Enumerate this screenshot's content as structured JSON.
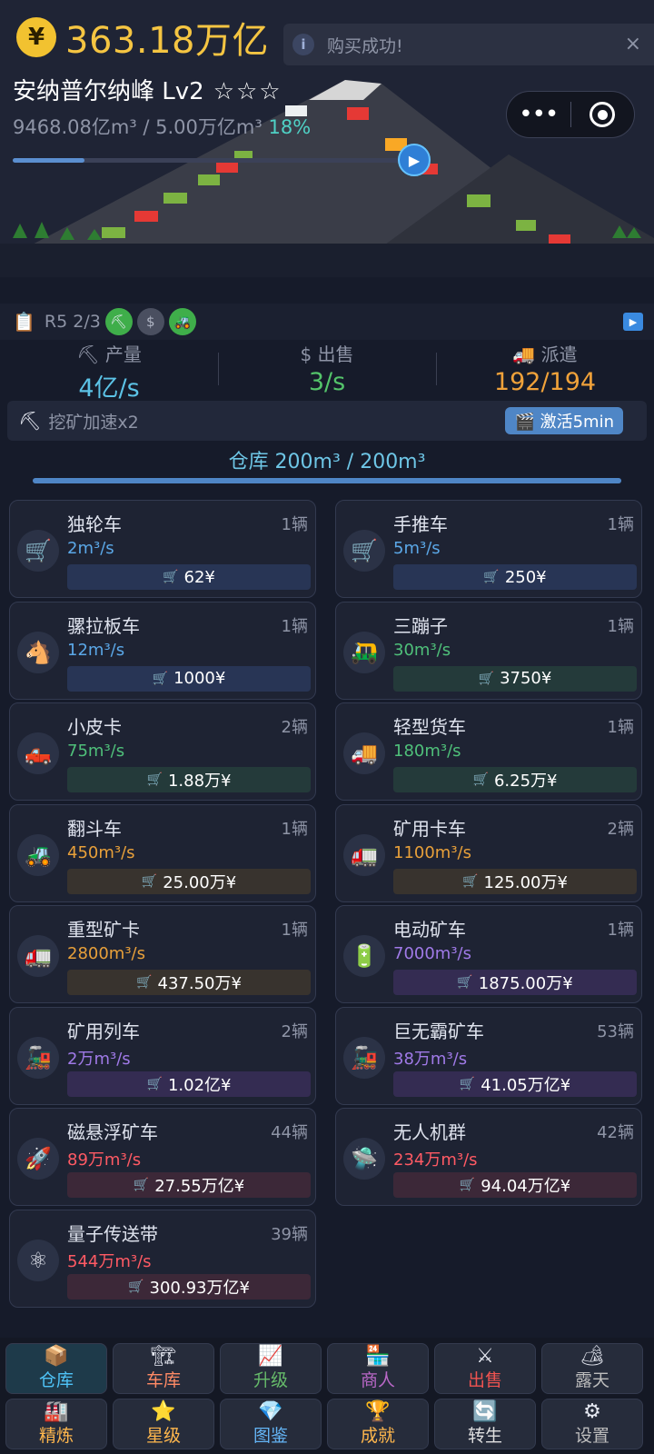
{
  "header": {
    "coin_symbol": "¥",
    "money": "363.18万亿",
    "mine_name": "安纳普尔纳峰 Lv2",
    "stars": "☆☆☆",
    "volume": "9468.08亿m³ / 5.00万亿m³",
    "volume_pct": "18%",
    "progress_fraction": 0.18
  },
  "toast": {
    "info": "i",
    "text": "购买成功!",
    "close": "×"
  },
  "strip": {
    "label": "R5 2/3",
    "badge_pick": "⛏",
    "badge_dollar": "$",
    "badge_tractor": "🚜"
  },
  "stats": [
    {
      "icon": "⛏",
      "label": "产量",
      "value": "4亿/s"
    },
    {
      "icon": "$",
      "label": "出售",
      "value": "3/s"
    },
    {
      "icon": "🚚",
      "label": "派遣",
      "value": "192/194"
    }
  ],
  "boost": {
    "text": "挖矿加速x2",
    "button": "🎬 激活5min"
  },
  "warehouse": {
    "text": "仓库 200m³ / 200m³",
    "fill_fraction": 1.0
  },
  "vehicles": [
    {
      "name": "独轮车",
      "count": "1辆",
      "rate": "2m³/s",
      "price": "62¥",
      "icon": "🛒",
      "tier": "blue"
    },
    {
      "name": "手推车",
      "count": "1辆",
      "rate": "5m³/s",
      "price": "250¥",
      "icon": "🛒",
      "tier": "blue"
    },
    {
      "name": "骡拉板车",
      "count": "1辆",
      "rate": "12m³/s",
      "price": "1000¥",
      "icon": "🐴",
      "tier": "blue"
    },
    {
      "name": "三蹦子",
      "count": "1辆",
      "rate": "30m³/s",
      "price": "3750¥",
      "icon": "🛺",
      "tier": "green"
    },
    {
      "name": "小皮卡",
      "count": "2辆",
      "rate": "75m³/s",
      "price": "1.88万¥",
      "icon": "🛻",
      "tier": "green"
    },
    {
      "name": "轻型货车",
      "count": "1辆",
      "rate": "180m³/s",
      "price": "6.25万¥",
      "icon": "🚚",
      "tier": "green"
    },
    {
      "name": "翻斗车",
      "count": "1辆",
      "rate": "450m³/s",
      "price": "25.00万¥",
      "icon": "🚜",
      "tier": "orange"
    },
    {
      "name": "矿用卡车",
      "count": "2辆",
      "rate": "1100m³/s",
      "price": "125.00万¥",
      "icon": "🚛",
      "tier": "orange"
    },
    {
      "name": "重型矿卡",
      "count": "1辆",
      "rate": "2800m³/s",
      "price": "437.50万¥",
      "icon": "🚛",
      "tier": "orange"
    },
    {
      "name": "电动矿车",
      "count": "1辆",
      "rate": "7000m³/s",
      "price": "1875.00万¥",
      "icon": "🔋",
      "tier": "purple"
    },
    {
      "name": "矿用列车",
      "count": "2辆",
      "rate": "2万m³/s",
      "price": "1.02亿¥",
      "icon": "🚂",
      "tier": "purple"
    },
    {
      "name": "巨无霸矿车",
      "count": "53辆",
      "rate": "38万m³/s",
      "price": "41.05万亿¥",
      "icon": "🚂",
      "tier": "purple"
    },
    {
      "name": "磁悬浮矿车",
      "count": "44辆",
      "rate": "89万m³/s",
      "price": "27.55万亿¥",
      "icon": "🚀",
      "tier": "red"
    },
    {
      "name": "无人机群",
      "count": "42辆",
      "rate": "234万m³/s",
      "price": "94.04万亿¥",
      "icon": "🛸",
      "tier": "red"
    },
    {
      "name": "量子传送带",
      "count": "39辆",
      "rate": "544万m³/s",
      "price": "300.93万亿¥",
      "icon": "⚛",
      "tier": "red"
    }
  ],
  "nav": [
    {
      "label": "仓库",
      "icon": "📦",
      "color": "#4fc3f7"
    },
    {
      "label": "车库",
      "icon": "🏗",
      "color": "#ff8a65"
    },
    {
      "label": "升级",
      "icon": "📈",
      "color": "#66bb6a"
    },
    {
      "label": "商人",
      "icon": "🏪",
      "color": "#ba68c8"
    },
    {
      "label": "出售",
      "icon": "⚔",
      "color": "#ef5350"
    },
    {
      "label": "露天",
      "icon": "🏕",
      "color": "#bdbdbd"
    },
    {
      "label": "精炼",
      "icon": "🏭",
      "color": "#ffb74d"
    },
    {
      "label": "星级",
      "icon": "⭐",
      "color": "#ffb74d"
    },
    {
      "label": "图鉴",
      "icon": "💎",
      "color": "#64b5f6"
    },
    {
      "label": "成就",
      "icon": "🏆",
      "color": "#ffb74d"
    },
    {
      "label": "转生",
      "icon": "🔄",
      "color": "#e0e0e0"
    },
    {
      "label": "设置",
      "icon": "⚙",
      "color": "#bdbdbd"
    }
  ],
  "colors": {
    "money": "#f5c542",
    "tier_blue": "#5ba8e8",
    "tier_green": "#4fc07a",
    "tier_orange": "#e8a03a",
    "tier_purple": "#a07ae8",
    "tier_red": "#ff5a64"
  }
}
